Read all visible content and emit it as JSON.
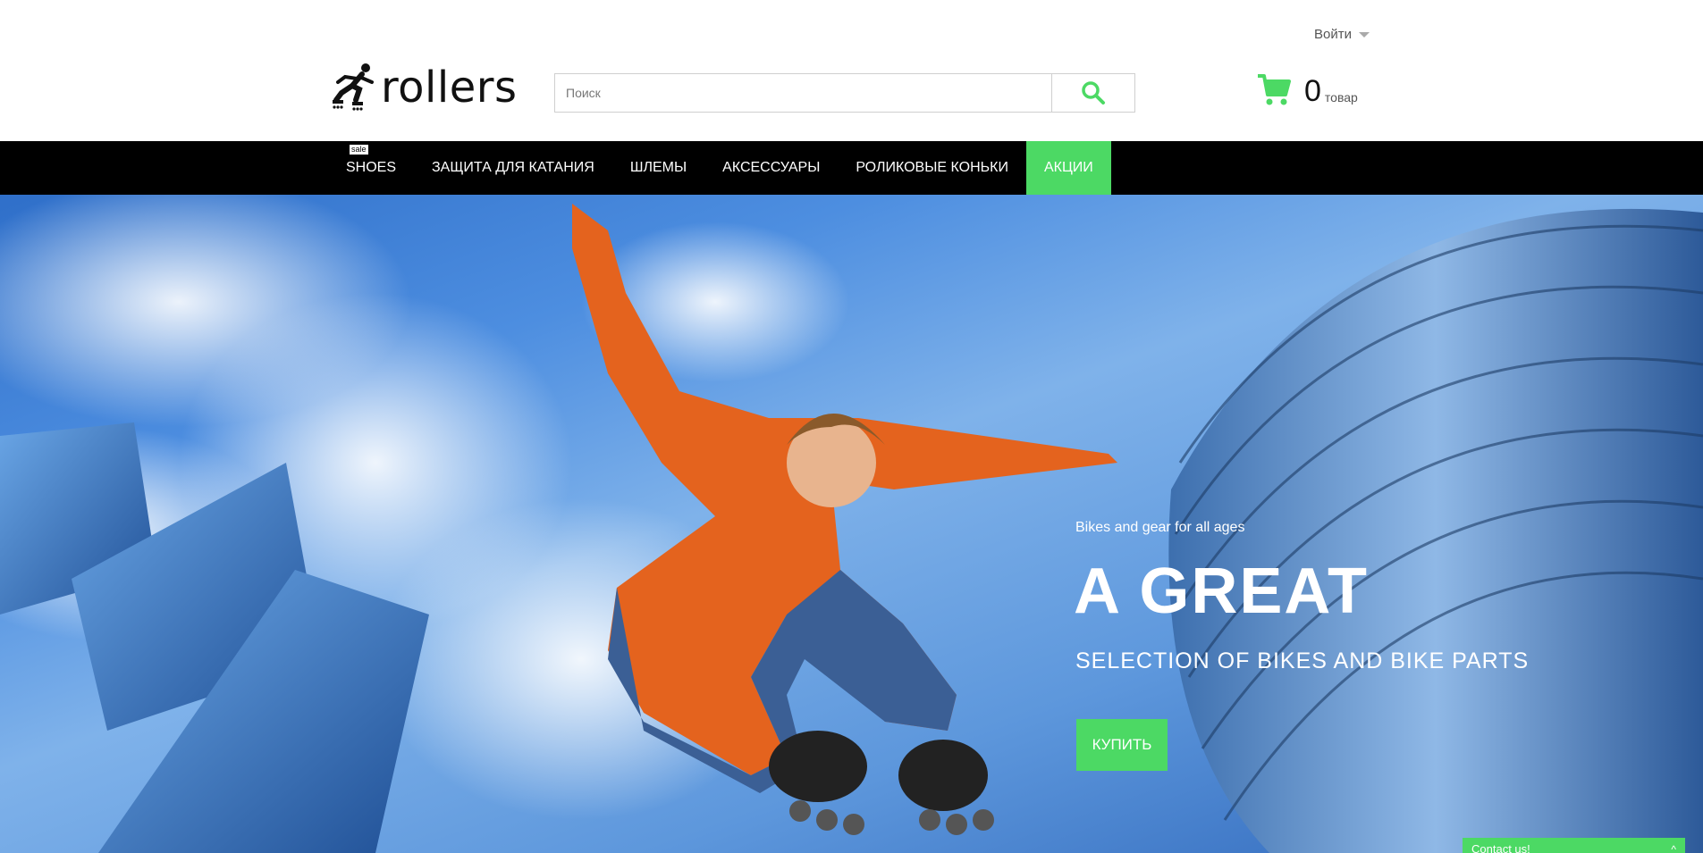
{
  "header": {
    "login_label": "Войти",
    "logo_text": "rollers",
    "search_placeholder": "Поиск",
    "cart_count": "0",
    "cart_label": "товар"
  },
  "nav": {
    "items": [
      {
        "label": "SHOES",
        "badge": "sale"
      },
      {
        "label": "ЗАЩИТА ДЛЯ КАТАНИЯ"
      },
      {
        "label": "ШЛЕМЫ"
      },
      {
        "label": "АКСЕССУАРЫ"
      },
      {
        "label": "РОЛИКОВЫЕ КОНЬКИ"
      },
      {
        "label": "АКЦИИ"
      }
    ],
    "active_index": 5
  },
  "hero": {
    "subtitle": "Bikes and gear for all ages",
    "title": "A GREAT",
    "title2": "SELECTION OF BIKES AND BIKE PARTS",
    "button_label": "КУПИТЬ"
  },
  "contact": {
    "label": "Contact us!"
  },
  "colors": {
    "accent": "#4cd964",
    "nav_bg": "#000000"
  },
  "icons": {
    "search": "search-icon",
    "cart": "cart-icon",
    "caret": "caret-down-icon"
  }
}
